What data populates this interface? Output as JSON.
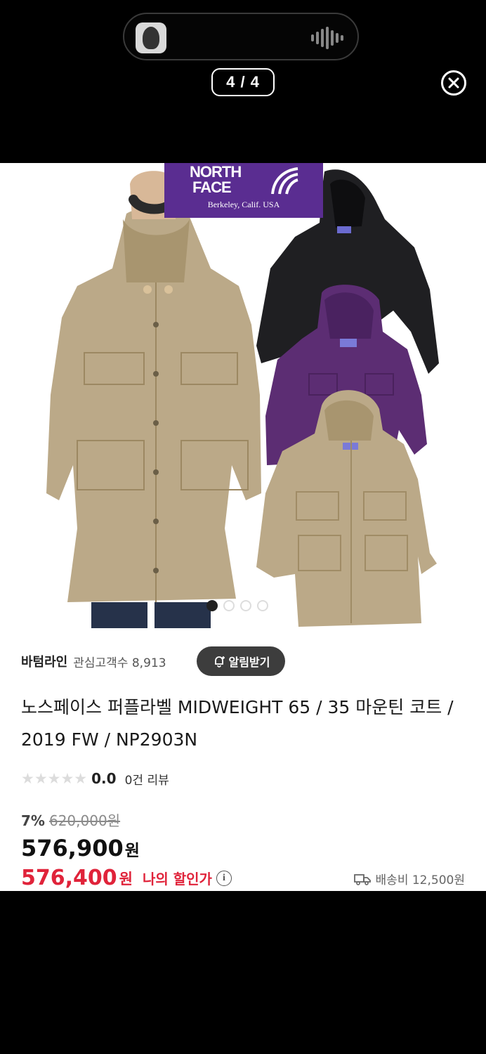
{
  "viewer": {
    "counter": "4 / 4"
  },
  "hero": {
    "logo": {
      "line1": "NORTH",
      "line2": "FACE",
      "line3": "Berkeley, Calif. USA"
    },
    "page_dots": {
      "count": 4,
      "active_index": 0
    }
  },
  "seller": {
    "name": "바텀라인",
    "fans": "관심고객수 8,913",
    "alert_label": "알림받기"
  },
  "product": {
    "title": "노스페이스 퍼플라벨 MIDWEIGHT 65 / 35 마운틴 코트 / 2019 FW / NP2903N",
    "rating_value": "0.0",
    "reviews_label": "0건 리뷰",
    "discount_pct": "7%",
    "original_price": "620,000원",
    "price": "576,900",
    "price_unit": "원",
    "my_price": "576,400",
    "my_price_unit": "원",
    "my_price_label": "나의 할인가",
    "shipping": "배송비 12,500원"
  },
  "colors": {
    "brand_purple": "#5a2d91",
    "accent_red": "#e0233a",
    "coat_beige": "#bba988",
    "coat_black": "#1f1f22",
    "coat_purple": "#5c2d73"
  }
}
